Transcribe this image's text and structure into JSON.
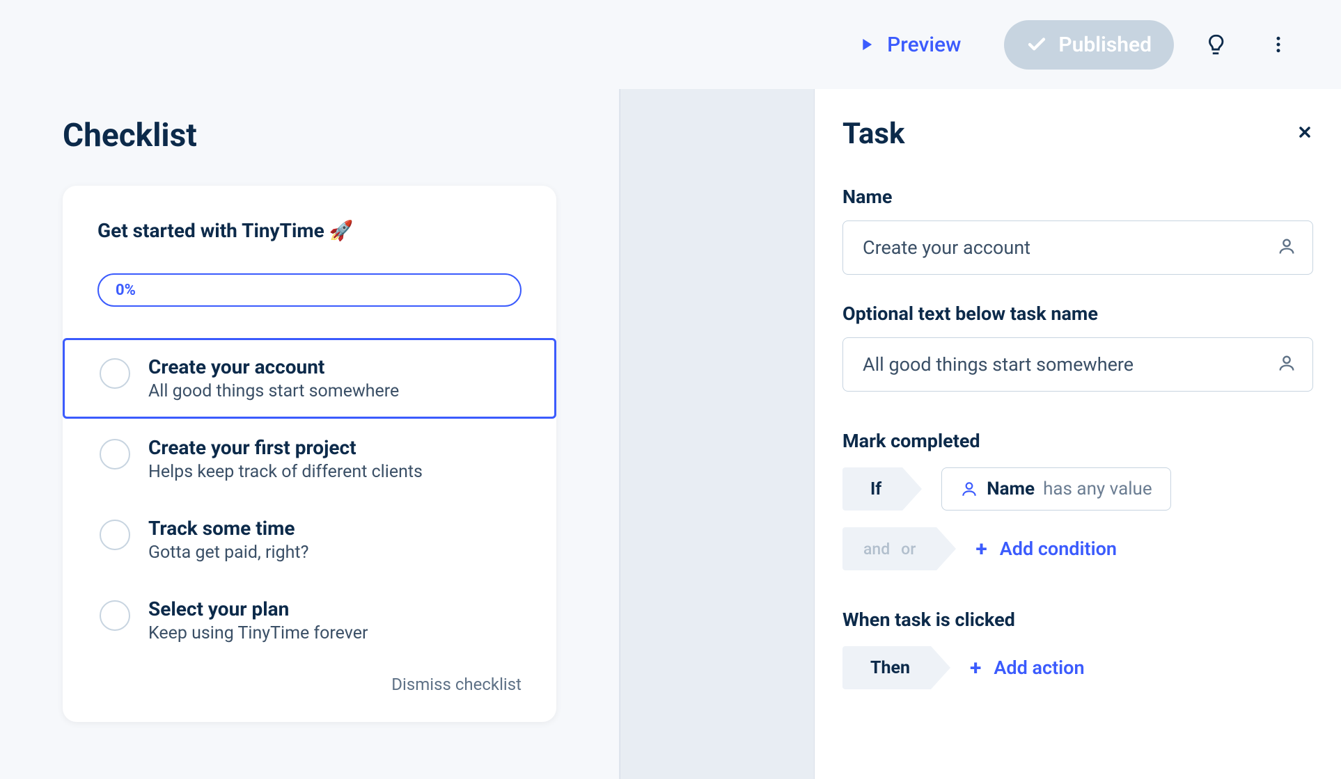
{
  "header": {
    "preview": "Preview",
    "published": "Published"
  },
  "checklist": {
    "title": "Checklist",
    "card_title": "Get started with TinyTime 🚀",
    "progress": "0%",
    "tasks": [
      {
        "title": "Create your account",
        "subtitle": "All good things start somewhere"
      },
      {
        "title": "Create your first project",
        "subtitle": "Helps keep track of different clients"
      },
      {
        "title": "Track some time",
        "subtitle": "Gotta get paid, right?"
      },
      {
        "title": "Select your plan",
        "subtitle": "Keep using TinyTime forever"
      }
    ],
    "dismiss": "Dismiss checklist"
  },
  "panel": {
    "title": "Task",
    "name_label": "Name",
    "name_value": "Create your account",
    "optional_label": "Optional text below task name",
    "optional_value": "All good things start somewhere",
    "mark_label": "Mark completed",
    "if_label": "If",
    "cond_field": "Name",
    "cond_predicate": "has any value",
    "andor_and": "and",
    "andor_or": "or",
    "add_condition": "Add condition",
    "clicked_label": "When task is clicked",
    "then_label": "Then",
    "add_action": "Add action"
  }
}
